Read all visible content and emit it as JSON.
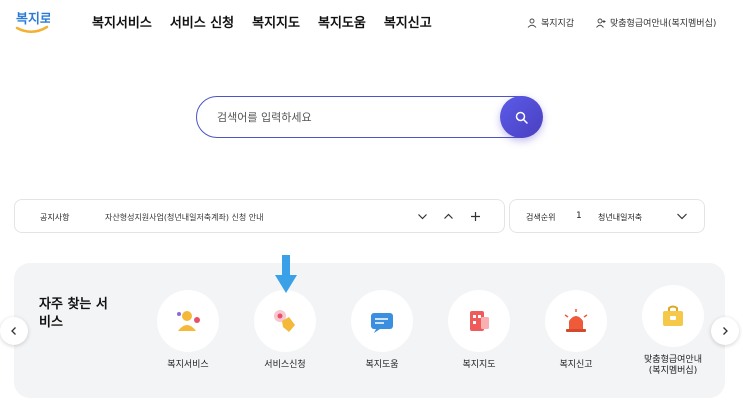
{
  "header": {
    "logo_text": "복지로",
    "nav": [
      "복지서비스",
      "서비스 신청",
      "복지지도",
      "복지도움",
      "복지신고"
    ],
    "util": {
      "wallet": "복지지갑",
      "custom": "맞춤형급여안내(복지멤버십)"
    }
  },
  "search": {
    "placeholder": "검색어를 입력하세요"
  },
  "notice": {
    "label": "공지사항",
    "text": "자산형성지원사업(청년내일저축계좌) 신청 안내"
  },
  "rank": {
    "label": "검색순위",
    "number": "1",
    "text": "청년내일저축"
  },
  "favorites": {
    "title": "자주 찾는 서비스",
    "items": [
      {
        "label": "복지서비스",
        "icon": "people-icon"
      },
      {
        "label": "서비스신청",
        "icon": "hand-tap-icon"
      },
      {
        "label": "복지도움",
        "icon": "chat-icon"
      },
      {
        "label": "복지지도",
        "icon": "map-icon"
      },
      {
        "label": "복지신고",
        "icon": "siren-icon"
      },
      {
        "label": "맞춤형급여안내\n(복지멤버십)",
        "icon": "briefcase-icon"
      }
    ]
  },
  "colors": {
    "accent": "#4b55c8",
    "search_button": "#5b5ce8",
    "pointer": "#3aa0e8"
  }
}
